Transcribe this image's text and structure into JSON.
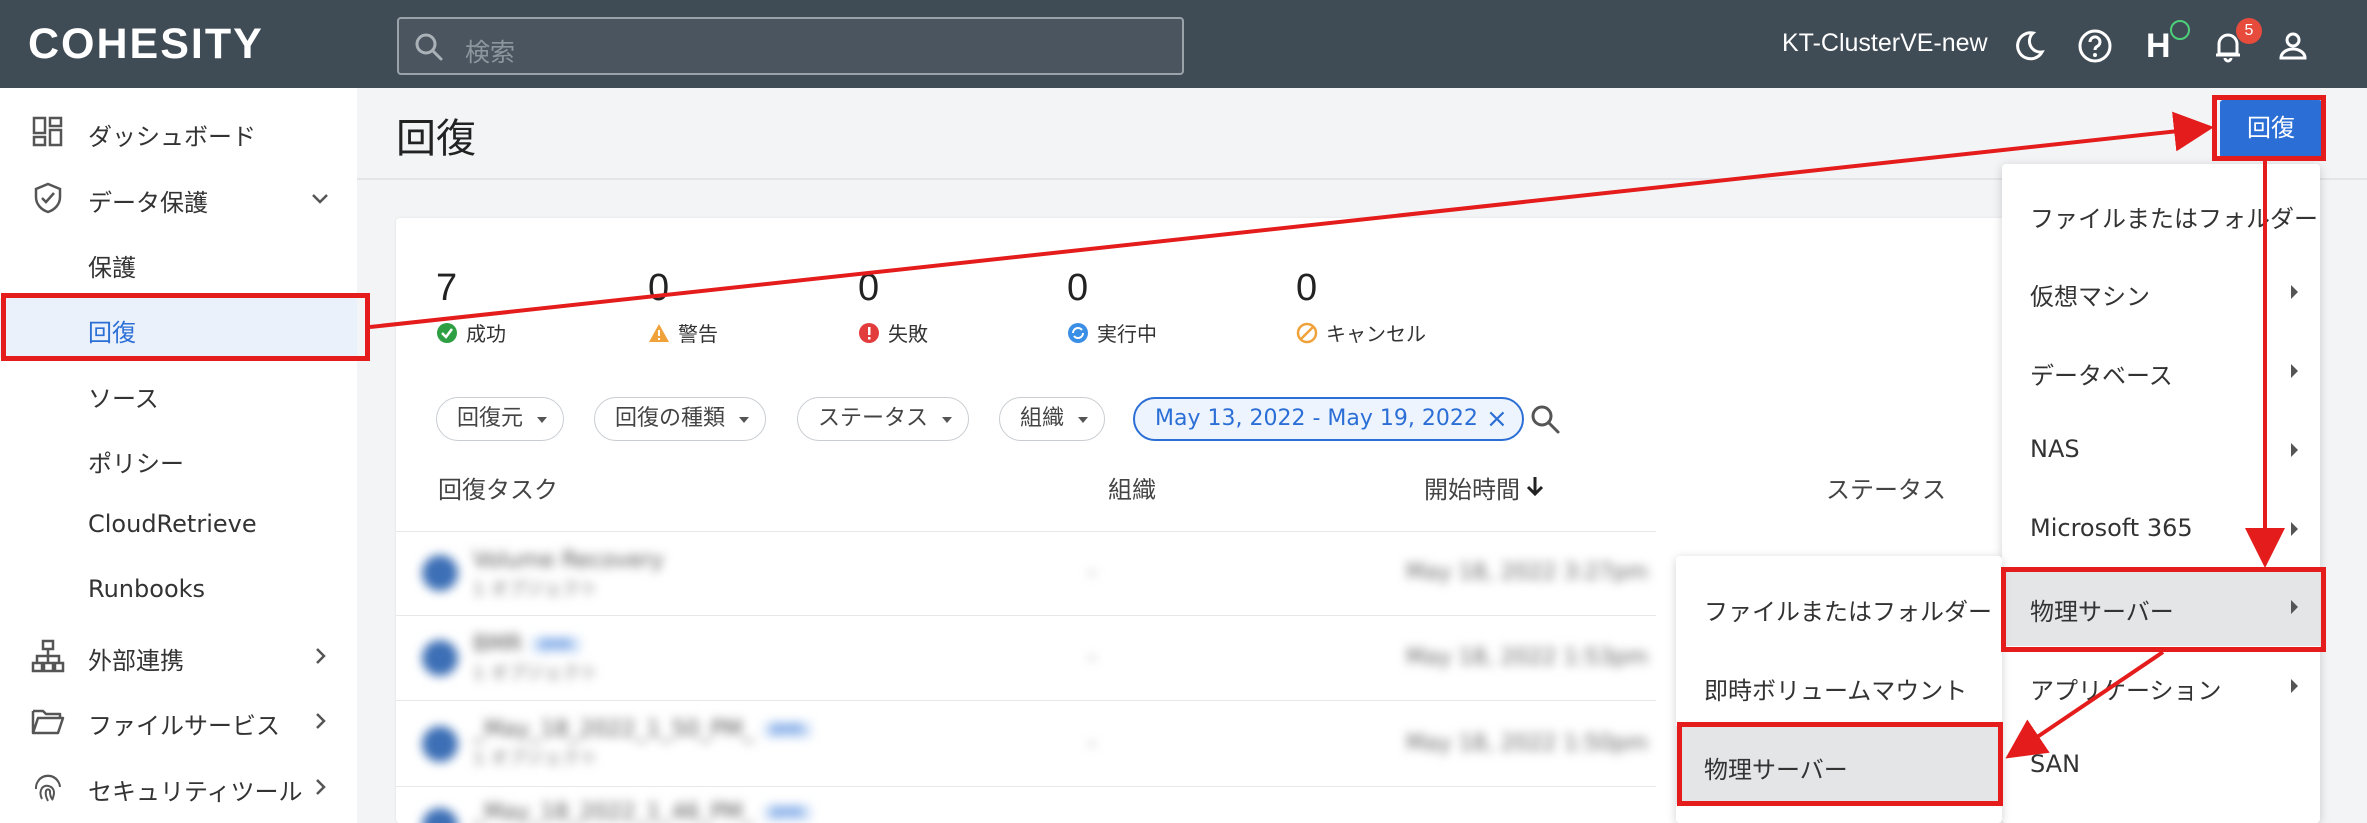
{
  "header": {
    "logo": "COHESITY",
    "search_placeholder": "検索",
    "cluster_name": "KT-ClusterVE-new",
    "help_letter": "H",
    "notification_count": "5"
  },
  "sidebar": {
    "items": [
      {
        "label": "ダッシュボード"
      },
      {
        "label": "データ保護"
      },
      {
        "label": "保護"
      },
      {
        "label": "回復"
      },
      {
        "label": "ソース"
      },
      {
        "label": "ポリシー"
      },
      {
        "label": "CloudRetrieve"
      },
      {
        "label": "Runbooks"
      },
      {
        "label": "外部連携"
      },
      {
        "label": "ファイルサービス"
      },
      {
        "label": "セキュリティツール"
      }
    ]
  },
  "main": {
    "title": "回復",
    "recover_button": "回復",
    "stats": [
      {
        "value": "7",
        "label": "成功",
        "color": "#2ea043"
      },
      {
        "value": "0",
        "label": "警告",
        "color": "#f0a23a"
      },
      {
        "value": "0",
        "label": "失敗",
        "color": "#e23c3c"
      },
      {
        "value": "0",
        "label": "実行中",
        "color": "#3a8ee6"
      },
      {
        "value": "0",
        "label": "キャンセル",
        "color": "#f0a23a"
      }
    ],
    "filters": [
      "回復元",
      "回復の種類",
      "ステータス",
      "組織"
    ],
    "date_range": "May 13, 2022 - May 19, 2022",
    "columns": [
      "回復タスク",
      "組織",
      "開始時間",
      "ステータス"
    ],
    "rows": [
      {
        "name": "Volume Recovery",
        "sub": "1 オブジェクト",
        "org": "-",
        "start": "May 18, 2022 3:27pm",
        "tag": ""
      },
      {
        "name": "BMR",
        "sub": "1 オブジェクト",
        "org": "-",
        "start": "May 18, 2022 1:53pm",
        "tag": "BMR"
      },
      {
        "name": "_May_18_2022_1_50_PM_",
        "sub": "1 オブジェクト",
        "org": "-",
        "start": "May 18, 2022 1:50pm",
        "tag": "BMR"
      },
      {
        "name": "_May_18_2022_1_46_PM_",
        "sub": "",
        "org": "",
        "start": "",
        "tag": "BMR"
      }
    ]
  },
  "recover_menu": {
    "items": [
      {
        "label": "ファイルまたはフォルダー",
        "submenu": false
      },
      {
        "label": "仮想マシン",
        "submenu": true
      },
      {
        "label": "データベース",
        "submenu": true
      },
      {
        "label": "NAS",
        "submenu": true
      },
      {
        "label": "Microsoft 365",
        "submenu": true
      },
      {
        "label": "物理サーバー",
        "submenu": true
      },
      {
        "label": "アプリケーション",
        "submenu": true
      },
      {
        "label": "SAN",
        "submenu": false
      }
    ]
  },
  "physical_submenu": {
    "items": [
      {
        "label": "ファイルまたはフォルダー"
      },
      {
        "label": "即時ボリュームマウント"
      },
      {
        "label": "物理サーバー"
      }
    ]
  },
  "colors": {
    "topbar": "#3f4b55",
    "accent": "#2b6fd6",
    "annotation": "#e41c1c"
  }
}
